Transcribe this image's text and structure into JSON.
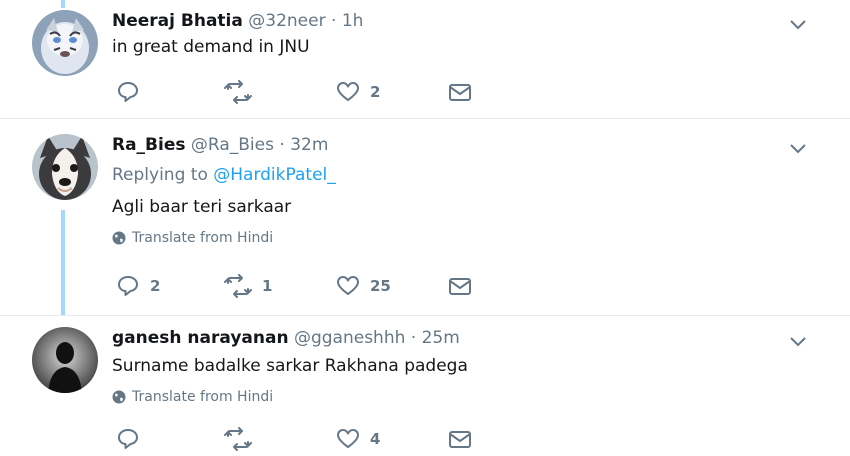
{
  "tweets": [
    {
      "name": "Neeraj Bhatia",
      "handle": "@32neer",
      "time": "1h",
      "text": "in great demand in JNU",
      "replies": "",
      "retweets": "",
      "likes": "2"
    },
    {
      "name": "Ra_Bies",
      "handle": "@Ra_Bies",
      "time": "32m",
      "replying_label": "Replying to",
      "replying_handle": "@HardikPatel_",
      "text": "Agli baar teri sarkaar",
      "translate": "Translate from Hindi",
      "replies": "2",
      "retweets": "1",
      "likes": "25"
    },
    {
      "name": "ganesh narayanan",
      "handle": "@gganeshhh",
      "time": "25m",
      "text": "Surname badalke sarkar Rakhana padega",
      "translate": "Translate from Hindi",
      "replies": "",
      "retweets": "",
      "likes": "4"
    }
  ],
  "separator": "·",
  "icons": {
    "reply": "reply-icon",
    "retweet": "retweet-icon",
    "like": "heart-icon",
    "dm": "envelope-icon",
    "more": "chevron-down-icon",
    "globe": "globe-icon"
  },
  "colors": {
    "link": "#1da1f2",
    "meta": "#657786",
    "thread": "#a6d8ff"
  }
}
